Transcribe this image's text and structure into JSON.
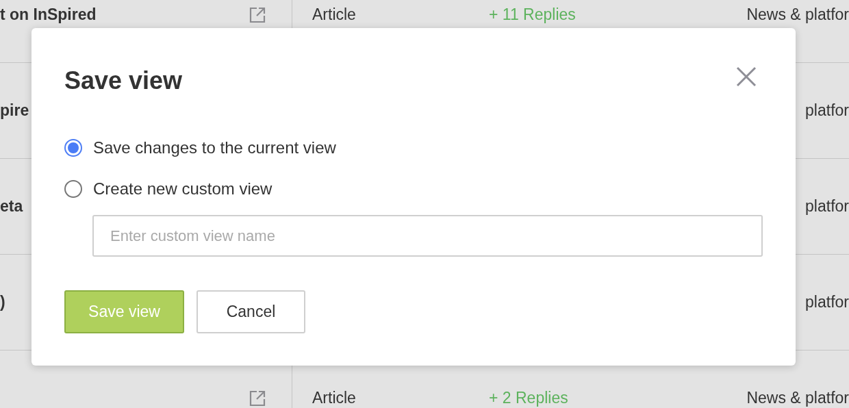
{
  "table": {
    "rows": [
      {
        "title": "t on InSpired",
        "link_icon": true,
        "type": "Article",
        "replies": "+ 11 Replies",
        "category": "News & platfor"
      },
      {
        "title": "pire",
        "link_icon": false,
        "category": "platfor"
      },
      {
        "title": "eta",
        "link_icon": false,
        "category": "platfor"
      },
      {
        "title": ")",
        "link_icon": false,
        "category": "platfor"
      },
      {
        "link_icon": true,
        "type": "Article",
        "replies": "+ 2 Replies",
        "category": "News & platfor"
      }
    ]
  },
  "dialog": {
    "title": "Save view",
    "options": [
      {
        "label": "Save changes to the current view",
        "selected": true
      },
      {
        "label": "Create new custom view",
        "selected": false
      }
    ],
    "input": {
      "placeholder": "Enter custom view name"
    },
    "buttons": [
      {
        "label": "Save view",
        "kind": "primary"
      },
      {
        "label": "Cancel",
        "kind": "secondary"
      }
    ]
  }
}
